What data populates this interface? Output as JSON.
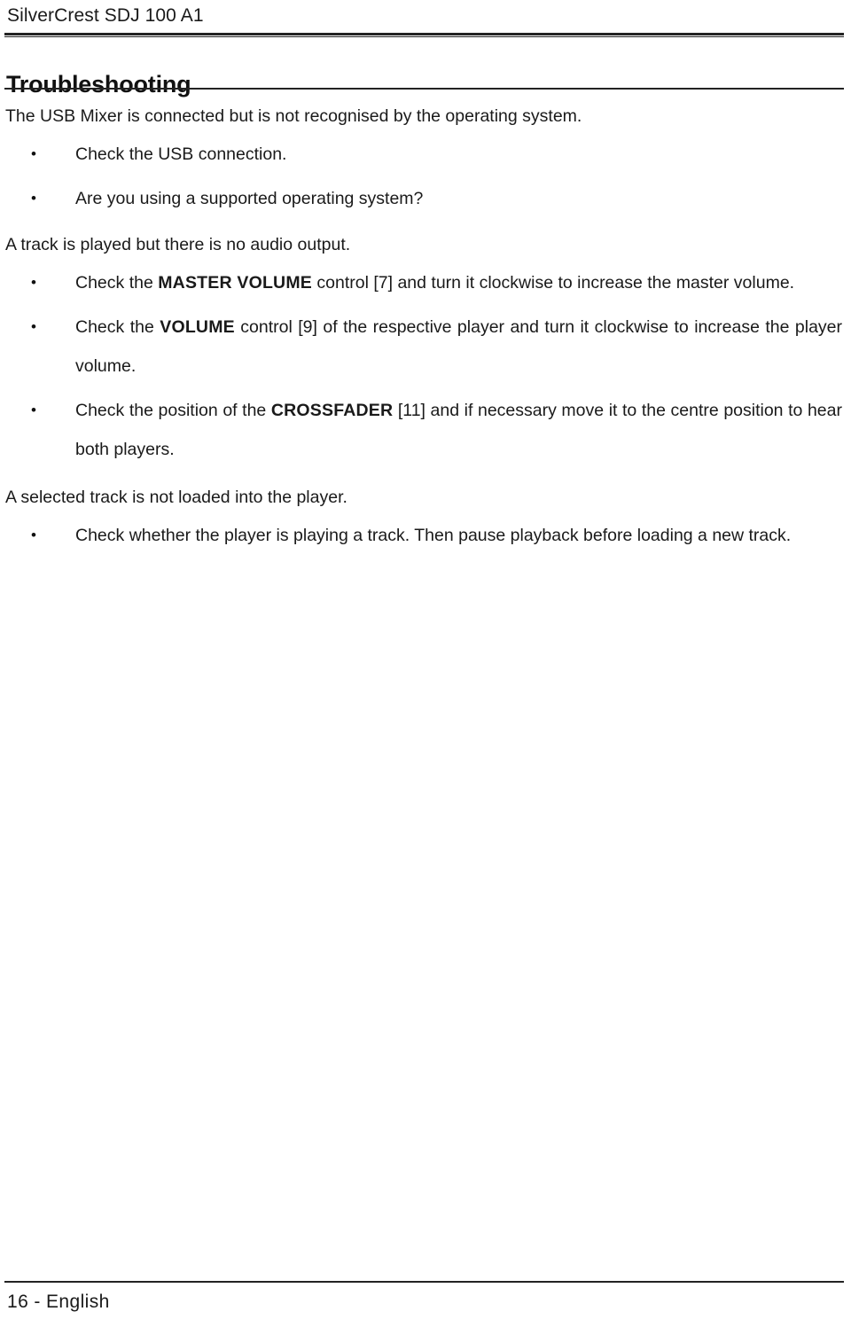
{
  "header": {
    "product_title": "SilverCrest SDJ 100 A1"
  },
  "heading": {
    "chapter_title": "Troubleshooting"
  },
  "bullet_glyph": "•",
  "sections": [
    {
      "problem": "The USB Mixer is connected but is not recognised by the operating system.",
      "items": [
        {
          "pre": "Check the USB connection.",
          "bold": "",
          "post": ""
        },
        {
          "pre": "Are you using a supported operating system?",
          "bold": "",
          "post": ""
        }
      ]
    },
    {
      "problem": "A track is played but there is no audio output.",
      "items": [
        {
          "pre": "Check the ",
          "bold": "MASTER VOLUME",
          "post": " control [7] and turn it clockwise to increase the master volume."
        },
        {
          "pre": "Check the ",
          "bold": "VOLUME",
          "post": " control [9] of the respective player and turn it clockwise to increase the player volume."
        },
        {
          "pre": "Check the position of the ",
          "bold": "CROSSFADER",
          "post": " [11] and if necessary move it to the centre position to hear both players."
        }
      ]
    },
    {
      "problem": "A selected track is not loaded into the player.",
      "items": [
        {
          "pre": "Check whether the player is playing a track. Then pause playback before loading a new track.",
          "bold": "",
          "post": ""
        }
      ]
    }
  ],
  "footer": {
    "page_label": "16 - English"
  }
}
